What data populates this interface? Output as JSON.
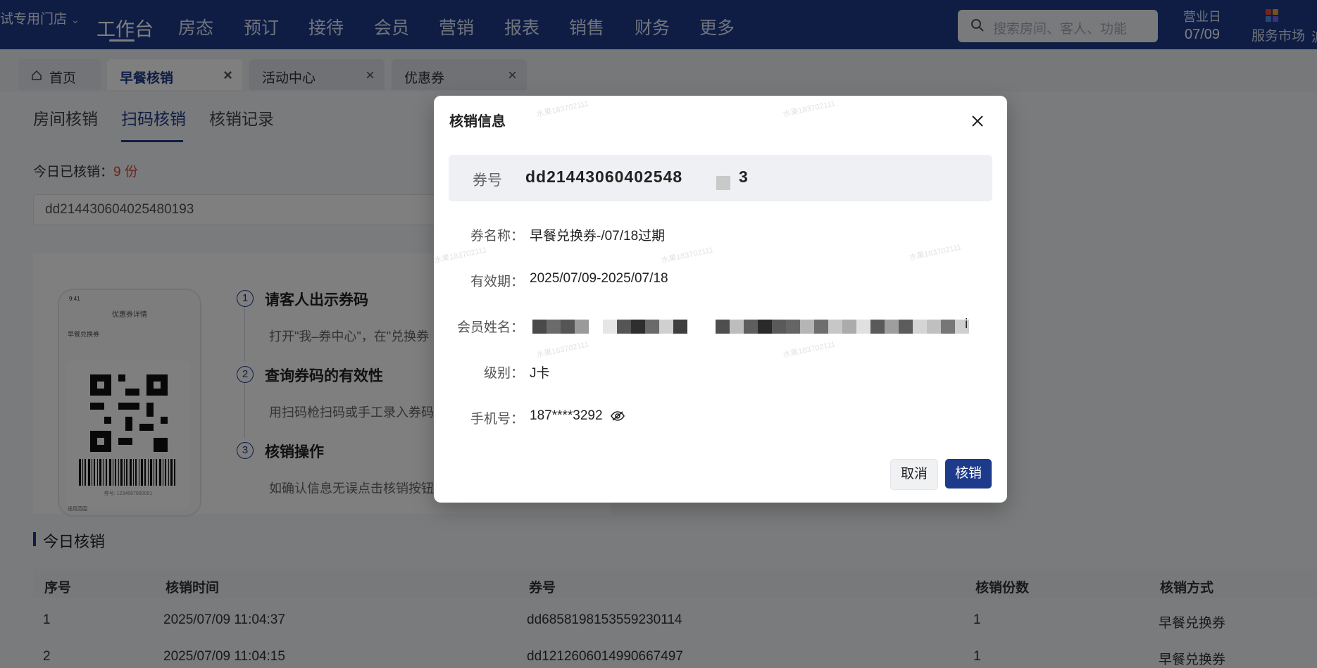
{
  "topnav": {
    "store": "试专用门店",
    "items": [
      "工作台",
      "房态",
      "预订",
      "接待",
      "会员",
      "营销",
      "报表",
      "销售",
      "财务",
      "更多"
    ],
    "search_placeholder": "搜索房间、客人、功能",
    "bizday_label": "营业日",
    "bizday_date": "07/09",
    "service_label": "服务市场",
    "overflow": "派"
  },
  "pagetabs": [
    {
      "label": "首页"
    },
    {
      "label": "早餐核销"
    },
    {
      "label": "活动中心"
    },
    {
      "label": "优惠券"
    }
  ],
  "subtabs": [
    "房间核销",
    "扫码核销",
    "核销记录"
  ],
  "today": {
    "label": "今日已核销：",
    "count": "9 份"
  },
  "scan_value": "dd214430604025480193",
  "phone": {
    "time": "9:41",
    "title": "优惠券详情",
    "name": "早餐兑换券",
    "number": "券号: 1234567890001",
    "footer": "适用范围"
  },
  "steps": [
    {
      "num": "1",
      "title": "请客人出示券码",
      "desc": "打开\"我–券中心\"，在\"兑换券"
    },
    {
      "num": "2",
      "title": "查询券码的有效性",
      "desc": "用扫码枪扫码或手工录入券码"
    },
    {
      "num": "3",
      "title": "核销操作",
      "desc": "如确认信息无误点击核销按钮"
    }
  ],
  "today_table": {
    "title": "今日核销",
    "headers": [
      "序号",
      "核销时间",
      "券号",
      "核销份数",
      "核销方式"
    ],
    "rows": [
      [
        "1",
        "2025/07/09 11:04:37",
        "dd6858198153559230114",
        "1",
        "早餐兑换券"
      ],
      [
        "2",
        "2025/07/09 11:04:15",
        "dd1212606014990667497",
        "1",
        "早餐兑换券"
      ]
    ]
  },
  "modal": {
    "title": "核销信息",
    "coupon_label": "券号",
    "coupon_value": "dd21443060402548",
    "coupon_tail": "3",
    "fields": [
      {
        "label": "券名称：",
        "value": "早餐兑换券-/07/18过期"
      },
      {
        "label": "有效期：",
        "value": "2025/07/09-2025/07/18"
      },
      {
        "label": "会员姓名：",
        "value": "i"
      },
      {
        "label": "级别：",
        "value": "J卡"
      },
      {
        "label": "手机号：",
        "value": "187****3292"
      }
    ],
    "cancel": "取消",
    "confirm": "核销"
  },
  "watermark": "水果183702111",
  "colors": {
    "primary": "#1e3a8a",
    "accent_red": "#d94a38"
  }
}
